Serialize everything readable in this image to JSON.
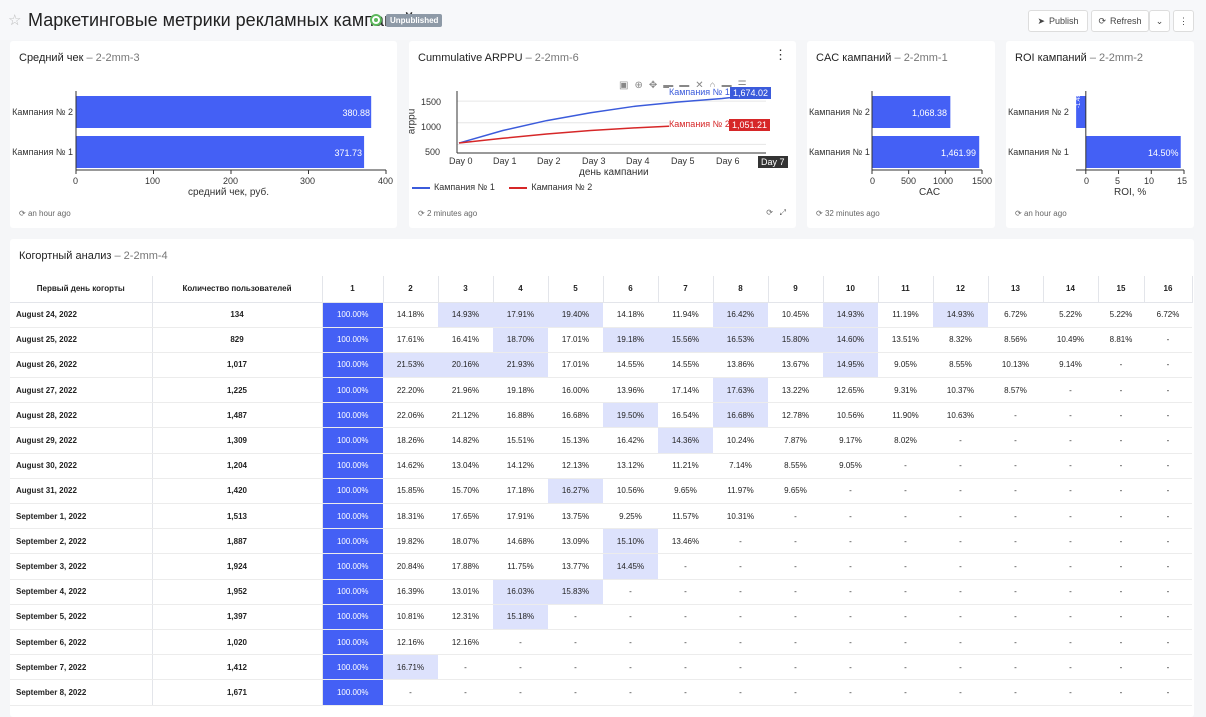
{
  "header": {
    "title": "Маркетинговые метрики рекламных кампаний",
    "badge": "Unpublished",
    "publish_label": "Publish",
    "refresh_label": "Refresh"
  },
  "cards": {
    "avg_check": {
      "title": "Средний чек",
      "subtitle": "2-2mm-3",
      "footer": "an hour ago",
      "categories": [
        "Кампания № 2",
        "Кампания № 1"
      ],
      "values": [
        "380.88",
        "371.73"
      ],
      "ticks": [
        "0",
        "100",
        "200",
        "300",
        "400"
      ],
      "xlabel": "средний чек, руб."
    },
    "arppu": {
      "title": "Cummulative ARPPU",
      "subtitle": "2-2mm-6",
      "footer": "2 minutes ago",
      "yticks": [
        "1500",
        "1000",
        "500"
      ],
      "ylabel": "arppu",
      "xticks": [
        "Day 0",
        "Day 1",
        "Day 2",
        "Day 3",
        "Day 4",
        "Day 5",
        "Day 6"
      ],
      "xlabel": "день кампании",
      "hover_label": "Day 7",
      "series1_name": "Кампания № 1",
      "series2_name": "Кампания № 2",
      "series1_last": "1,674.02",
      "series2_last": "1,051.21"
    },
    "cac": {
      "title": "CAC кампаний",
      "subtitle": "2-2mm-1",
      "footer": "32 minutes ago",
      "categories": [
        "Кампания № 2",
        "Кампания № 1"
      ],
      "values": [
        "1,068.38",
        "1,461.99"
      ],
      "ticks": [
        "0",
        "500",
        "1000",
        "1500"
      ],
      "xlabel": "CAC"
    },
    "roi": {
      "title": "ROI кампаний",
      "subtitle": "2-2mm-2",
      "footer": "an hour ago",
      "categories": [
        "Кампания № 2",
        "Кампания № 1"
      ],
      "values": [
        "-1.48%",
        "14.50%"
      ],
      "ticks": [
        "0",
        "5",
        "10",
        "15"
      ],
      "xlabel": "ROI, %"
    }
  },
  "cohort": {
    "title": "Когортный анализ",
    "subtitle": "2-2mm-4",
    "col_date": "Первый день когорты",
    "col_users": "Количество пользователей",
    "day_headers": [
      "1",
      "2",
      "3",
      "4",
      "5",
      "6",
      "7",
      "8",
      "9",
      "10",
      "11",
      "12",
      "13",
      "14",
      "15",
      "16"
    ],
    "rows": [
      {
        "date": "August 24, 2022",
        "users": "134",
        "cells": [
          "100.00%",
          "14.18%",
          "14.93%",
          "17.91%",
          "19.40%",
          "14.18%",
          "11.94%",
          "16.42%",
          "10.45%",
          "14.93%",
          "11.19%",
          "14.93%",
          "6.72%",
          "5.22%",
          "5.22%",
          "6.72%"
        ]
      },
      {
        "date": "August 25, 2022",
        "users": "829",
        "cells": [
          "100.00%",
          "17.61%",
          "16.41%",
          "18.70%",
          "17.01%",
          "19.18%",
          "15.56%",
          "16.53%",
          "15.80%",
          "14.60%",
          "13.51%",
          "8.32%",
          "8.56%",
          "10.49%",
          "8.81%",
          "-"
        ]
      },
      {
        "date": "August 26, 2022",
        "users": "1,017",
        "cells": [
          "100.00%",
          "21.53%",
          "20.16%",
          "21.93%",
          "17.01%",
          "14.55%",
          "14.55%",
          "13.86%",
          "13.67%",
          "14.95%",
          "9.05%",
          "8.55%",
          "10.13%",
          "9.14%",
          "-",
          "-"
        ]
      },
      {
        "date": "August 27, 2022",
        "users": "1,225",
        "cells": [
          "100.00%",
          "22.20%",
          "21.96%",
          "19.18%",
          "16.00%",
          "13.96%",
          "17.14%",
          "17.63%",
          "13.22%",
          "12.65%",
          "9.31%",
          "10.37%",
          "8.57%",
          "-",
          "-",
          "-"
        ]
      },
      {
        "date": "August 28, 2022",
        "users": "1,487",
        "cells": [
          "100.00%",
          "22.06%",
          "21.12%",
          "16.88%",
          "16.68%",
          "19.50%",
          "16.54%",
          "16.68%",
          "12.78%",
          "10.56%",
          "11.90%",
          "10.63%",
          "-",
          "-",
          "-",
          "-"
        ]
      },
      {
        "date": "August 29, 2022",
        "users": "1,309",
        "cells": [
          "100.00%",
          "18.26%",
          "14.82%",
          "15.51%",
          "15.13%",
          "16.42%",
          "14.36%",
          "10.24%",
          "7.87%",
          "9.17%",
          "8.02%",
          "-",
          "-",
          "-",
          "-",
          "-"
        ]
      },
      {
        "date": "August 30, 2022",
        "users": "1,204",
        "cells": [
          "100.00%",
          "14.62%",
          "13.04%",
          "14.12%",
          "12.13%",
          "13.12%",
          "11.21%",
          "7.14%",
          "8.55%",
          "9.05%",
          "-",
          "-",
          "-",
          "-",
          "-",
          "-"
        ]
      },
      {
        "date": "August 31, 2022",
        "users": "1,420",
        "cells": [
          "100.00%",
          "15.85%",
          "15.70%",
          "17.18%",
          "16.27%",
          "10.56%",
          "9.65%",
          "11.97%",
          "9.65%",
          "-",
          "-",
          "-",
          "-",
          "-",
          "-",
          "-"
        ]
      },
      {
        "date": "September 1, 2022",
        "users": "1,513",
        "cells": [
          "100.00%",
          "18.31%",
          "17.65%",
          "17.91%",
          "13.75%",
          "9.25%",
          "11.57%",
          "10.31%",
          "-",
          "-",
          "-",
          "-",
          "-",
          "-",
          "-",
          "-"
        ]
      },
      {
        "date": "September 2, 2022",
        "users": "1,887",
        "cells": [
          "100.00%",
          "19.82%",
          "18.07%",
          "14.68%",
          "13.09%",
          "15.10%",
          "13.46%",
          "-",
          "-",
          "-",
          "-",
          "-",
          "-",
          "-",
          "-",
          "-"
        ]
      },
      {
        "date": "September 3, 2022",
        "users": "1,924",
        "cells": [
          "100.00%",
          "20.84%",
          "17.88%",
          "11.75%",
          "13.77%",
          "14.45%",
          "-",
          "-",
          "-",
          "-",
          "-",
          "-",
          "-",
          "-",
          "-",
          "-"
        ]
      },
      {
        "date": "September 4, 2022",
        "users": "1,952",
        "cells": [
          "100.00%",
          "16.39%",
          "13.01%",
          "16.03%",
          "15.83%",
          "-",
          "-",
          "-",
          "-",
          "-",
          "-",
          "-",
          "-",
          "-",
          "-",
          "-"
        ]
      },
      {
        "date": "September 5, 2022",
        "users": "1,397",
        "cells": [
          "100.00%",
          "10.81%",
          "12.31%",
          "15.18%",
          "-",
          "-",
          "-",
          "-",
          "-",
          "-",
          "-",
          "-",
          "-",
          "-",
          "-",
          "-"
        ]
      },
      {
        "date": "September 6, 2022",
        "users": "1,020",
        "cells": [
          "100.00%",
          "12.16%",
          "12.16%",
          "-",
          "-",
          "-",
          "-",
          "-",
          "-",
          "-",
          "-",
          "-",
          "-",
          "-",
          "-",
          "-"
        ]
      },
      {
        "date": "September 7, 2022",
        "users": "1,412",
        "cells": [
          "100.00%",
          "16.71%",
          "-",
          "-",
          "-",
          "-",
          "-",
          "-",
          "-",
          "-",
          "-",
          "-",
          "-",
          "-",
          "-",
          "-"
        ]
      },
      {
        "date": "September 8, 2022",
        "users": "1,671",
        "cells": [
          "100.00%",
          "-",
          "-",
          "-",
          "-",
          "-",
          "-",
          "-",
          "-",
          "-",
          "-",
          "-",
          "-",
          "-",
          "-",
          "-"
        ]
      }
    ]
  },
  "chart_data": [
    {
      "type": "bar",
      "title": "Средний чек",
      "categories": [
        "Кампания № 2",
        "Кампания № 1"
      ],
      "values": [
        380.88,
        371.73
      ],
      "xlabel": "средний чек, руб.",
      "xlim": [
        0,
        400
      ]
    },
    {
      "type": "line",
      "title": "Cummulative ARPPU",
      "x": [
        "Day 0",
        "Day 1",
        "Day 2",
        "Day 3",
        "Day 4",
        "Day 5",
        "Day 6",
        "Day 7"
      ],
      "series": [
        {
          "name": "Кампания № 1",
          "values": [
            530,
            820,
            1050,
            1230,
            1380,
            1480,
            1560,
            1674.02
          ]
        },
        {
          "name": "Кампания № 2",
          "values": [
            530,
            640,
            740,
            820,
            880,
            930,
            990,
            1051.21
          ]
        }
      ],
      "xlabel": "день кампании",
      "ylabel": "arppu",
      "ylim": [
        300,
        1850
      ]
    },
    {
      "type": "bar",
      "title": "CAC кампаний",
      "categories": [
        "Кампания № 2",
        "Кампания № 1"
      ],
      "values": [
        1068.38,
        1461.99
      ],
      "xlabel": "CAC",
      "xlim": [
        0,
        1500
      ]
    },
    {
      "type": "bar",
      "title": "ROI кампаний",
      "categories": [
        "Кампания № 2",
        "Кампания № 1"
      ],
      "values": [
        -1.48,
        14.5
      ],
      "xlabel": "ROI, %",
      "xlim": [
        -1.5,
        15
      ]
    }
  ],
  "colors": {
    "accent": "#4460f5",
    "series1": "#3b5bdb",
    "series2": "#d62728",
    "highlight": "#dde2fc"
  }
}
